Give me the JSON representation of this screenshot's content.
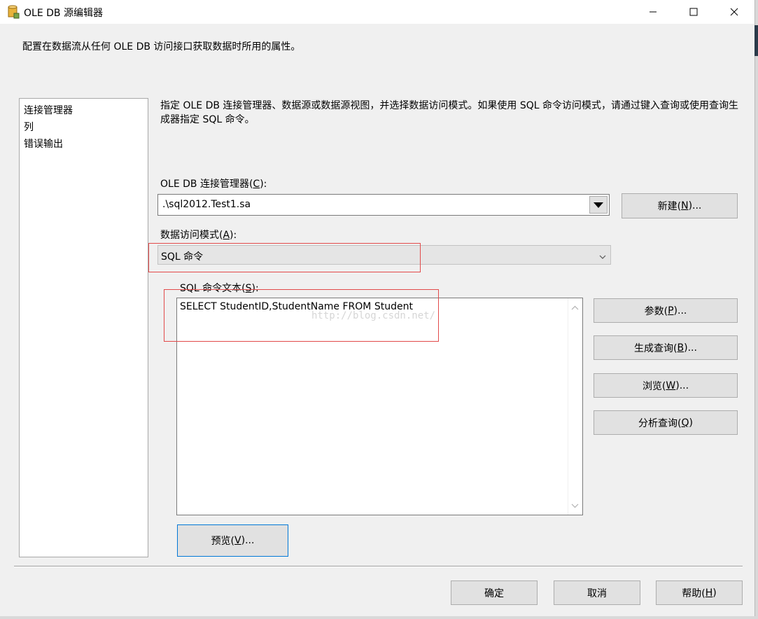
{
  "window": {
    "title": "OLE DB 源编辑器",
    "icon": "database-cylinder-icon"
  },
  "header": {
    "description": "配置在数据流从任何 OLE DB 访问接口获取数据时所用的属性。"
  },
  "nav": {
    "items": [
      {
        "label": "连接管理器"
      },
      {
        "label": "列"
      },
      {
        "label": "错误输出"
      }
    ]
  },
  "main": {
    "description": "指定 OLE DB 连接管理器、数据源或数据源视图，并选择数据访问模式。如果使用 SQL 命令访问模式，请通过键入查询或使用查询生成器指定 SQL 命令。",
    "connection_label_prefix": "OLE DB 连接管理器(",
    "connection_label_key": "C",
    "connection_label_suffix": "):",
    "connection_value": ".\\sql2012.Test1.sa",
    "new_button": {
      "prefix": "新建(",
      "key": "N",
      "suffix": ")..."
    },
    "mode_label_prefix": "数据访问模式(",
    "mode_label_key": "A",
    "mode_label_suffix": "):",
    "mode_value": "SQL 命令",
    "sql_label_prefix": "SQL 命令文本(",
    "sql_label_key": "S",
    "sql_label_suffix": "):",
    "sql_text": "SELECT StudentID,StudentName FROM Student",
    "watermark": "http://blog.csdn.net/",
    "buttons": {
      "params": {
        "prefix": "参数(",
        "key": "P",
        "suffix": ")..."
      },
      "build": {
        "prefix": "生成查询(",
        "key": "B",
        "suffix": ")..."
      },
      "browse": {
        "prefix": "浏览(",
        "key": "W",
        "suffix": ")..."
      },
      "parse": {
        "prefix": "分析查询(",
        "key": "Q",
        "suffix": ")"
      },
      "preview": {
        "prefix": "预览(",
        "key": "V",
        "suffix": ")..."
      }
    }
  },
  "footer": {
    "ok": "确定",
    "cancel": "取消",
    "help": {
      "prefix": "帮助(",
      "key": "H",
      "suffix": ")"
    }
  },
  "colors": {
    "annotation_red": "#e24a4a",
    "focus_blue": "#0078d7"
  }
}
